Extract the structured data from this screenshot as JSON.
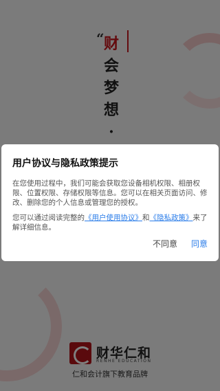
{
  "splash": {
    "quote_mark": "“",
    "slogan_chars": [
      "财",
      "会",
      "梦",
      "想",
      "·"
    ],
    "brand_name": "财华仁和",
    "brand_en": "RENHE EDUCATION",
    "tagline": "仁和会计旗下教育品牌"
  },
  "dialog": {
    "title": "用户协议与隐私政策提示",
    "paragraph1": "在您使用过程中，我们可能会获取您设备相机权限、相册权限、位置权限、存储权限等信息。您可以在相关页面访问、修改、删除您的个人信息或管理您的授权。",
    "p2_prefix": "您可以通过阅读完整的",
    "p2_link1": "《用户使用协议》",
    "p2_and": "和",
    "p2_link2": "《隐私政策》",
    "p2_suffix": "来了解详细信息。",
    "disagree_label": "不同意",
    "agree_label": "同意"
  },
  "colors": {
    "brand_red": "#c8161d",
    "link_blue": "#2b7de9"
  }
}
